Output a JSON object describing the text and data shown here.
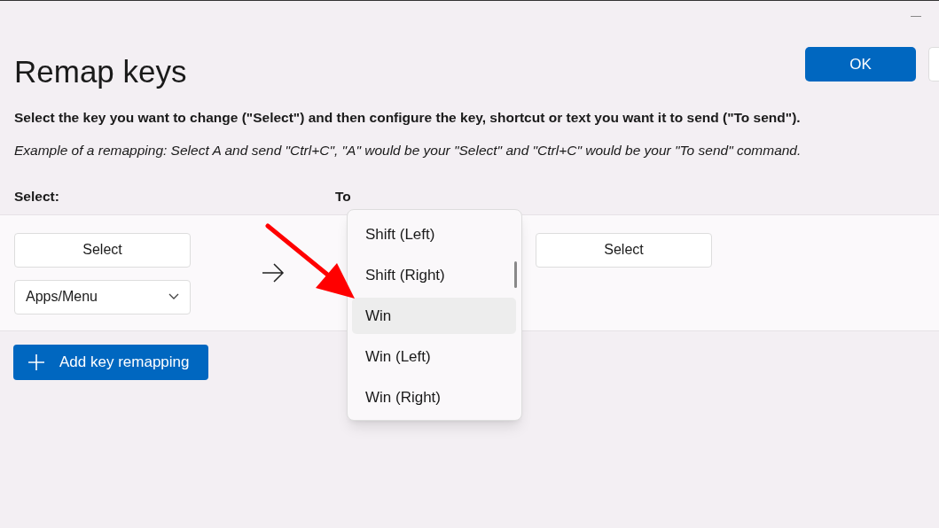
{
  "window": {
    "title": "Remap keys"
  },
  "ok_button": "OK",
  "instructions": "Select the key you want to change (\"Select\") and then configure the key, shortcut or text you want it to send (\"To send\").",
  "example": "Example of a remapping: Select A and send \"Ctrl+C\", \"A\" would be your \"Select\" and \"Ctrl+C\" would be your \"To send\" command.",
  "columns": [
    "Select:",
    "To"
  ],
  "row": {
    "select_button": "Select",
    "key_dropdown": "Apps/Menu",
    "to_select_button": "Select"
  },
  "add_button": "Add key remapping",
  "dropdown_list": [
    {
      "label": "Shift (Left)",
      "selected": false
    },
    {
      "label": "Shift (Right)",
      "selected": false
    },
    {
      "label": "Win",
      "selected": true
    },
    {
      "label": "Win (Left)",
      "selected": false
    },
    {
      "label": "Win (Right)",
      "selected": false
    }
  ]
}
